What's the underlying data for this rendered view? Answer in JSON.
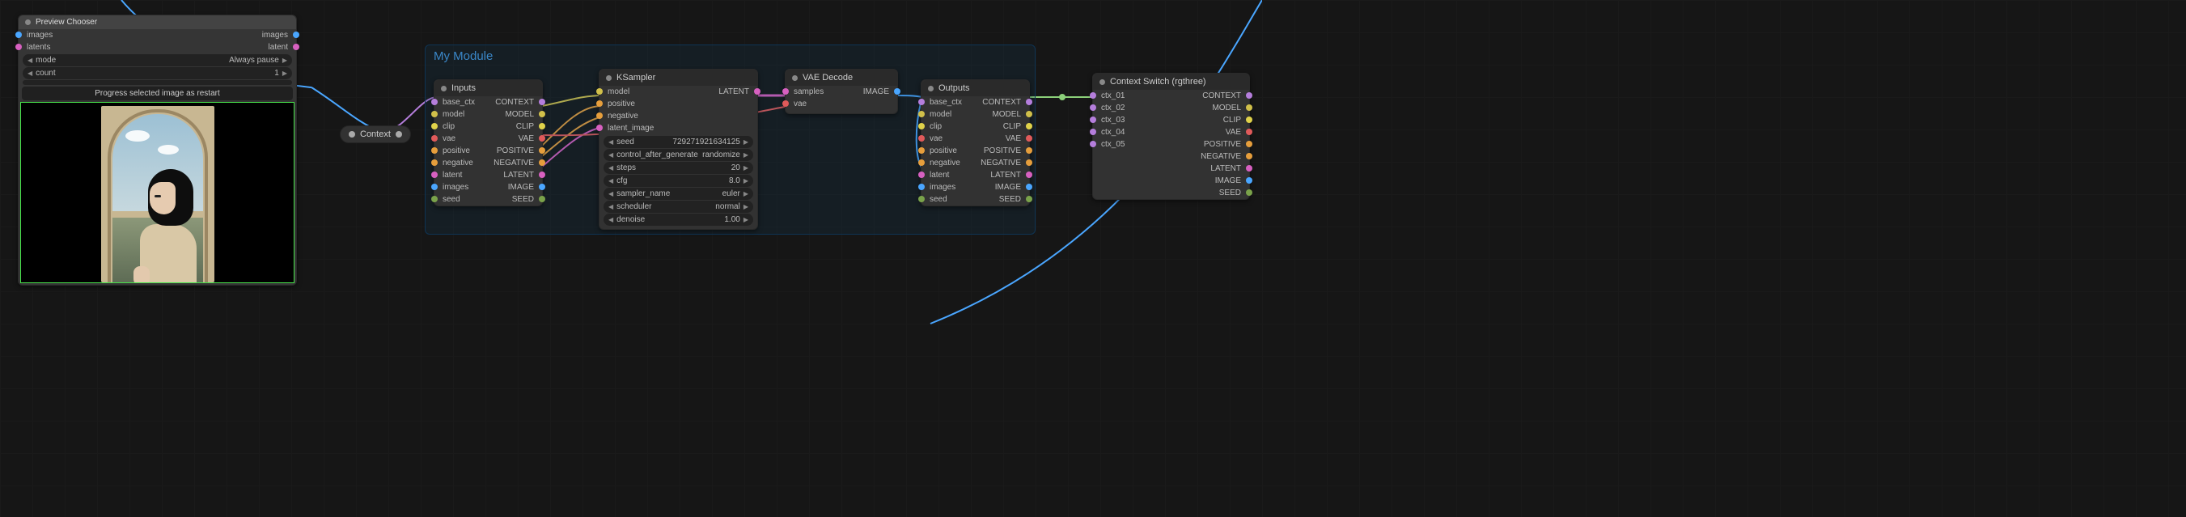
{
  "group": {
    "title": "My Module"
  },
  "colors": {
    "context": "#b57edc",
    "model": "#d1c04a",
    "clip": "#e0d24a",
    "vae": "#e05a5a",
    "positive": "#e69e3c",
    "negative": "#e69e3c",
    "latent": "#d760c0",
    "image": "#4aa6ff",
    "seed": "#7aa24a",
    "samples": "#d760c0"
  },
  "preview_chooser": {
    "title": "Preview Chooser",
    "in": [
      {
        "name": "images",
        "type": "",
        "color": "image"
      },
      {
        "name": "latents",
        "type": "",
        "color": "latent"
      }
    ],
    "out": [
      {
        "name": "images",
        "type": "",
        "color": "image"
      },
      {
        "name": "latent",
        "type": "",
        "color": "latent"
      }
    ],
    "widgets": [
      {
        "label": "mode",
        "value": "Always pause"
      },
      {
        "label": "count",
        "value": "1"
      }
    ],
    "button": "Progress selected image as restart"
  },
  "context_node": {
    "title": "Context"
  },
  "inputs_node": {
    "title": "Inputs",
    "out": [
      {
        "name": "base_ctx",
        "type": "CONTEXT",
        "color": "context"
      },
      {
        "name": "model",
        "type": "MODEL",
        "color": "model"
      },
      {
        "name": "clip",
        "type": "CLIP",
        "color": "clip"
      },
      {
        "name": "vae",
        "type": "VAE",
        "color": "vae"
      },
      {
        "name": "positive",
        "type": "POSITIVE",
        "color": "positive"
      },
      {
        "name": "negative",
        "type": "NEGATIVE",
        "color": "negative"
      },
      {
        "name": "latent",
        "type": "LATENT",
        "color": "latent"
      },
      {
        "name": "images",
        "type": "IMAGE",
        "color": "image"
      },
      {
        "name": "seed",
        "type": "SEED",
        "color": "seed"
      }
    ]
  },
  "ksampler": {
    "title": "KSampler",
    "in": [
      {
        "name": "model",
        "color": "model"
      },
      {
        "name": "positive",
        "color": "positive"
      },
      {
        "name": "negative",
        "color": "negative"
      },
      {
        "name": "latent_image",
        "color": "latent"
      }
    ],
    "out": [
      {
        "name": "",
        "type": "LATENT",
        "color": "latent"
      }
    ],
    "widgets": [
      {
        "label": "seed",
        "value": "729271921634125"
      },
      {
        "label": "control_after_generate",
        "value": "randomize"
      },
      {
        "label": "steps",
        "value": "20"
      },
      {
        "label": "cfg",
        "value": "8.0"
      },
      {
        "label": "sampler_name",
        "value": "euler"
      },
      {
        "label": "scheduler",
        "value": "normal"
      },
      {
        "label": "denoise",
        "value": "1.00"
      }
    ]
  },
  "vae_decode": {
    "title": "VAE Decode",
    "in": [
      {
        "name": "samples",
        "color": "samples"
      },
      {
        "name": "vae",
        "color": "vae"
      }
    ],
    "out": [
      {
        "name": "",
        "type": "IMAGE",
        "color": "image"
      }
    ]
  },
  "outputs_node": {
    "title": "Outputs",
    "rows": [
      {
        "name": "base_ctx",
        "type": "CONTEXT",
        "color": "context"
      },
      {
        "name": "model",
        "type": "MODEL",
        "color": "model"
      },
      {
        "name": "clip",
        "type": "CLIP",
        "color": "clip"
      },
      {
        "name": "vae",
        "type": "VAE",
        "color": "vae"
      },
      {
        "name": "positive",
        "type": "POSITIVE",
        "color": "positive"
      },
      {
        "name": "negative",
        "type": "NEGATIVE",
        "color": "negative"
      },
      {
        "name": "latent",
        "type": "LATENT",
        "color": "latent"
      },
      {
        "name": "images",
        "type": "IMAGE",
        "color": "image"
      },
      {
        "name": "seed",
        "type": "SEED",
        "color": "seed"
      }
    ]
  },
  "context_switch": {
    "title": "Context Switch (rgthree)",
    "in": [
      {
        "name": "ctx_01",
        "color": "context"
      },
      {
        "name": "ctx_02",
        "color": "context"
      },
      {
        "name": "ctx_03",
        "color": "context"
      },
      {
        "name": "ctx_04",
        "color": "context"
      },
      {
        "name": "ctx_05",
        "color": "context"
      }
    ],
    "out": [
      {
        "name": "",
        "type": "CONTEXT",
        "color": "context"
      },
      {
        "name": "",
        "type": "MODEL",
        "color": "model"
      },
      {
        "name": "",
        "type": "CLIP",
        "color": "clip"
      },
      {
        "name": "",
        "type": "VAE",
        "color": "vae"
      },
      {
        "name": "",
        "type": "POSITIVE",
        "color": "positive"
      },
      {
        "name": "",
        "type": "NEGATIVE",
        "color": "negative"
      },
      {
        "name": "",
        "type": "LATENT",
        "color": "latent"
      },
      {
        "name": "",
        "type": "IMAGE",
        "color": "image"
      },
      {
        "name": "",
        "type": "SEED",
        "color": "seed"
      }
    ]
  }
}
